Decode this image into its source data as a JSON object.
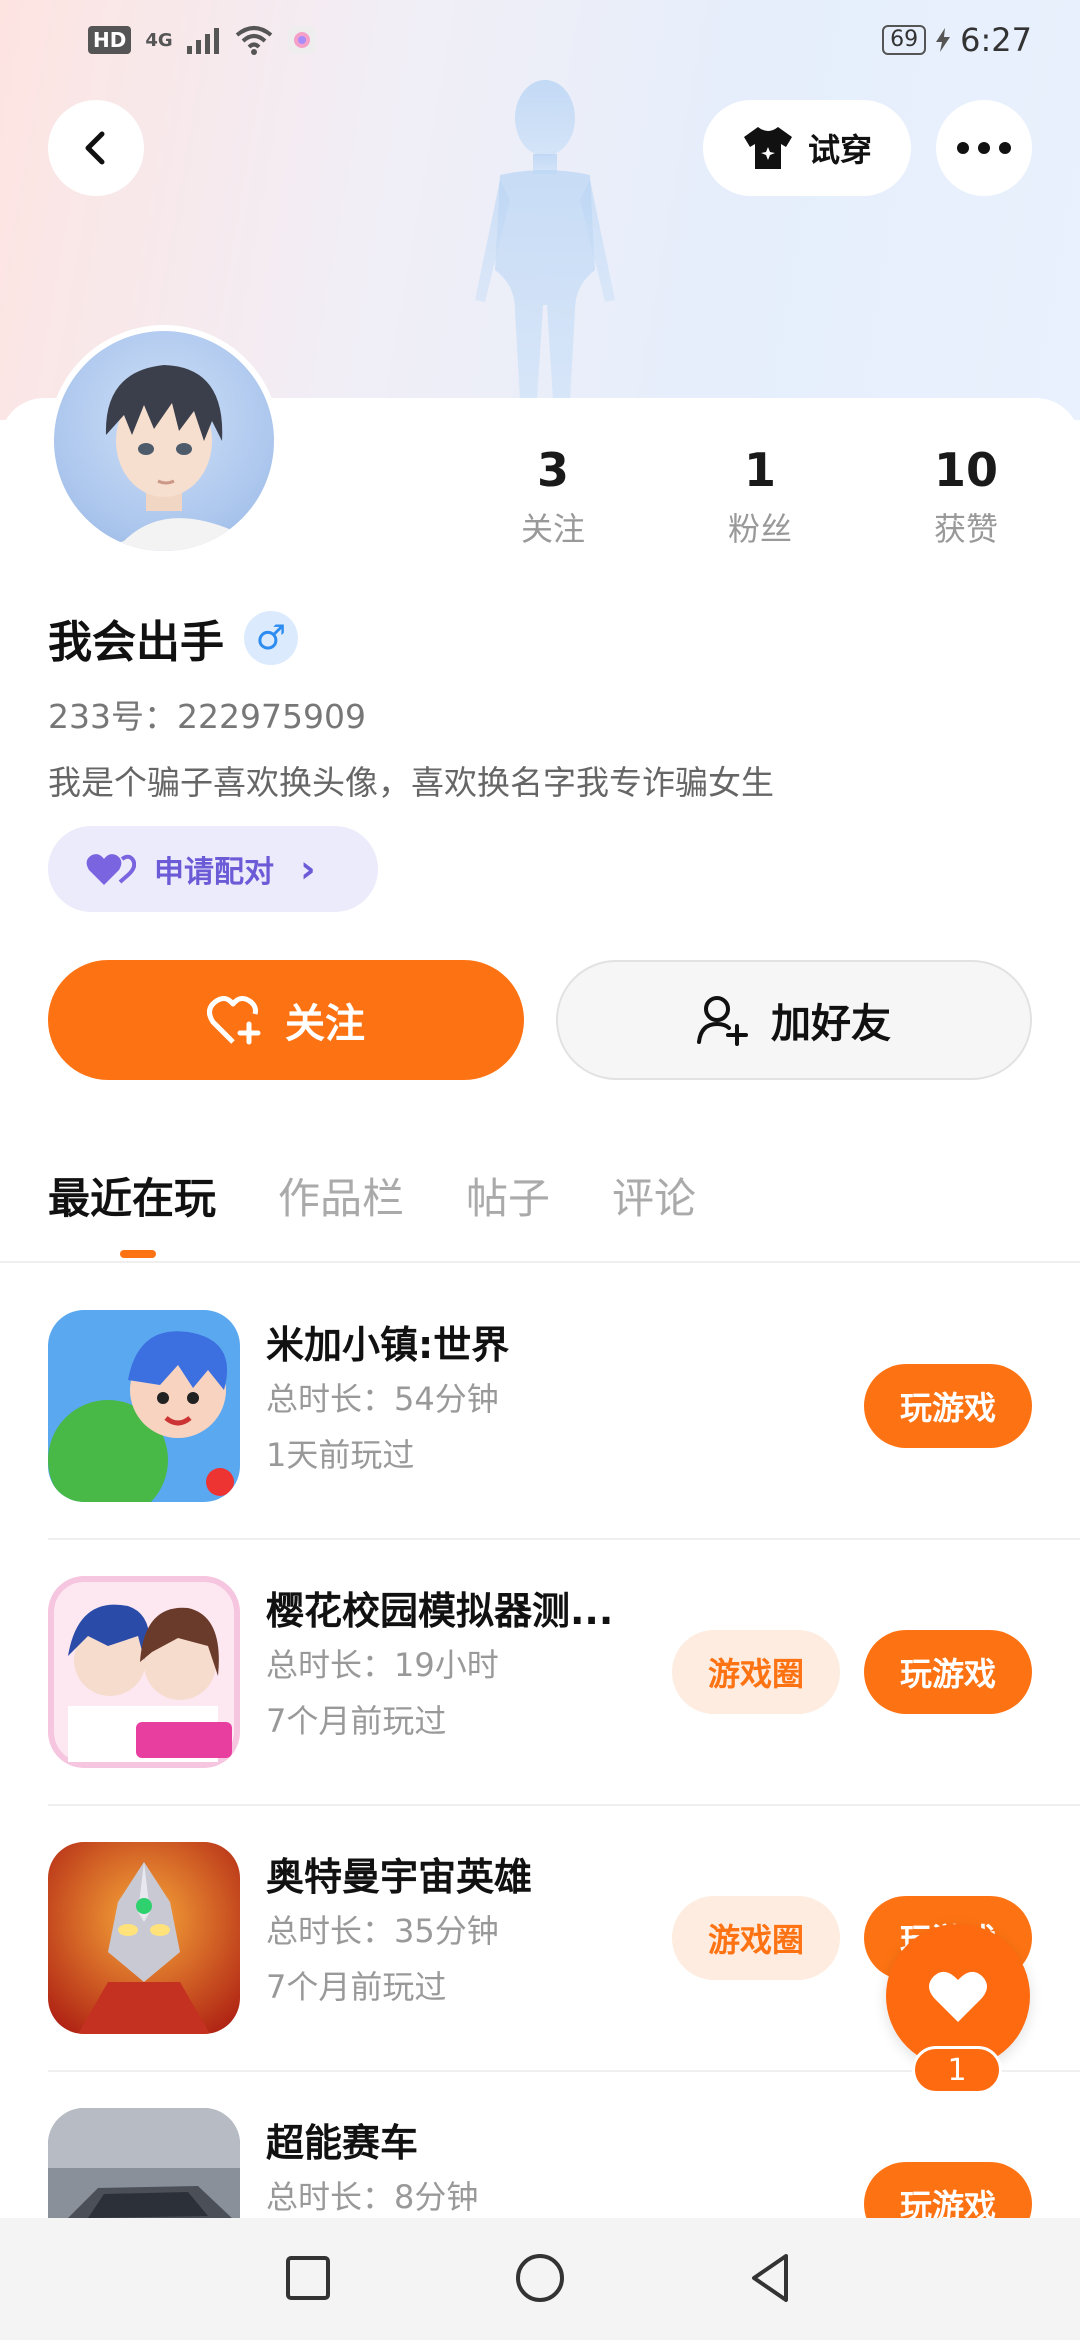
{
  "status_bar": {
    "hd": "HD",
    "network": "4G",
    "battery": "69",
    "time": "6:27"
  },
  "header": {
    "back_icon": "chevron-left-icon",
    "try_on_label": "试穿",
    "more_icon": "more-dots-icon"
  },
  "profile": {
    "stats": [
      {
        "value": "3",
        "label": "关注"
      },
      {
        "value": "1",
        "label": "粉丝"
      },
      {
        "value": "10",
        "label": "获赞"
      }
    ],
    "name": "我会出手",
    "gender_symbol": "♂",
    "uid": "233号：222975909",
    "bio": "我是个骗子喜欢换头像，喜欢换名字我专诈骗女生",
    "pair_label": "申请配对",
    "pair_arrow": "›"
  },
  "actions": {
    "follow_label": "关注",
    "add_friend_label": "加好友"
  },
  "tabs": [
    "最近在玩",
    "作品栏",
    "帖子",
    "评论"
  ],
  "games": [
    {
      "title": "米加小镇:世界",
      "duration": "总时长：54分钟",
      "last_played": "1天前玩过",
      "play_label": "玩游戏",
      "circle_label": ""
    },
    {
      "title": "樱花校园模拟器测...",
      "duration": "总时长：19小时",
      "last_played": "7个月前玩过",
      "play_label": "玩游戏",
      "circle_label": "游戏圈"
    },
    {
      "title": "奥特曼宇宙英雄",
      "duration": "总时长：35分钟",
      "last_played": "7个月前玩过",
      "play_label": "玩游戏",
      "circle_label": "游戏圈"
    },
    {
      "title": "超能赛车",
      "duration": "总时长：8分钟",
      "last_played": "",
      "play_label": "玩游戏",
      "circle_label": ""
    }
  ],
  "floating": {
    "like_count": "1"
  },
  "colors": {
    "accent": "#fd7313",
    "pair_bg": "#ecebfb",
    "pair_text": "#6b5bd7"
  }
}
